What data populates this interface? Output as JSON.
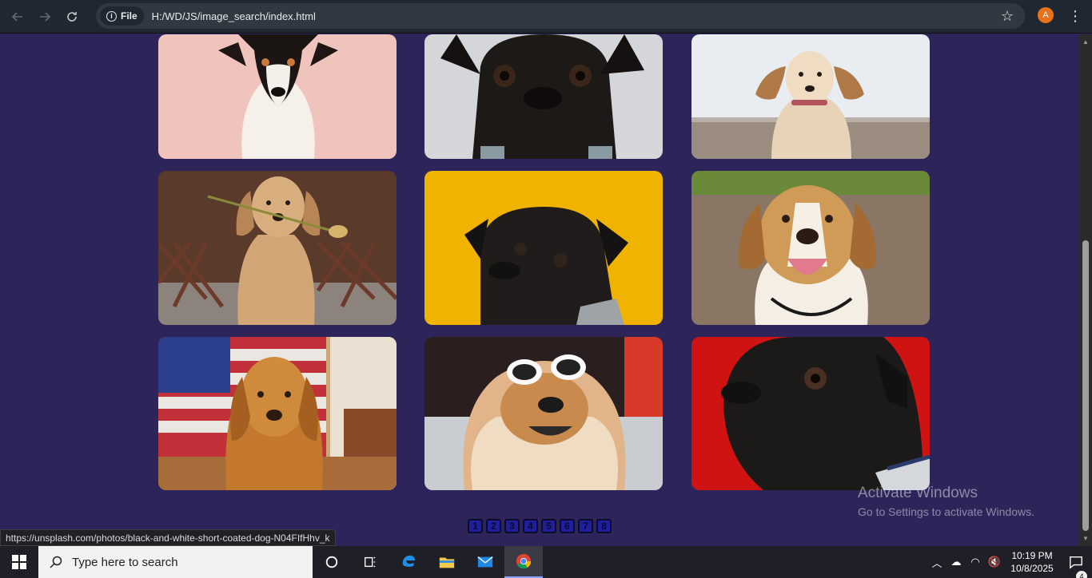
{
  "browser": {
    "site_chip": "File",
    "info_glyph": "i",
    "url": "H:/WD/JS/image_search/index.html",
    "avatar_letter": "A",
    "star_glyph": "☆",
    "menu_glyph": "⋮"
  },
  "gallery": {
    "images": [
      {
        "subject": "jack-russell-terrier-pink-background",
        "bg": "#f0c4bd"
      },
      {
        "subject": "black-pug-grey-background",
        "bg": "#d4d6d9"
      },
      {
        "subject": "spaniel-puppy-beach",
        "bg": "#e9ecf1"
      },
      {
        "subject": "golden-retriever-with-rose",
        "bg": "#5a3a2a"
      },
      {
        "subject": "black-pug-yellow-background",
        "bg": "#f0b400"
      },
      {
        "subject": "beagle-smiling",
        "bg": "#8a7664"
      },
      {
        "subject": "golden-retriever-american-flag",
        "bg": "#c9a77a"
      },
      {
        "subject": "chow-with-sunglasses",
        "bg": "#6d6d6d"
      },
      {
        "subject": "black-pug-red-background",
        "bg": "#cf1313"
      }
    ]
  },
  "pagination": {
    "pages": [
      "1",
      "2",
      "3",
      "4",
      "5",
      "6",
      "7",
      "8"
    ]
  },
  "status_bar": {
    "link": "https://unsplash.com/photos/black-and-white-short-coated-dog-N04FIfHhv_k"
  },
  "watermark": {
    "title": "Activate Windows",
    "subtitle": "Go to Settings to activate Windows."
  },
  "taskbar": {
    "search_placeholder": "Type here to search",
    "time": "10:19 PM",
    "date": "10/8/2025",
    "notification_count": "4"
  }
}
